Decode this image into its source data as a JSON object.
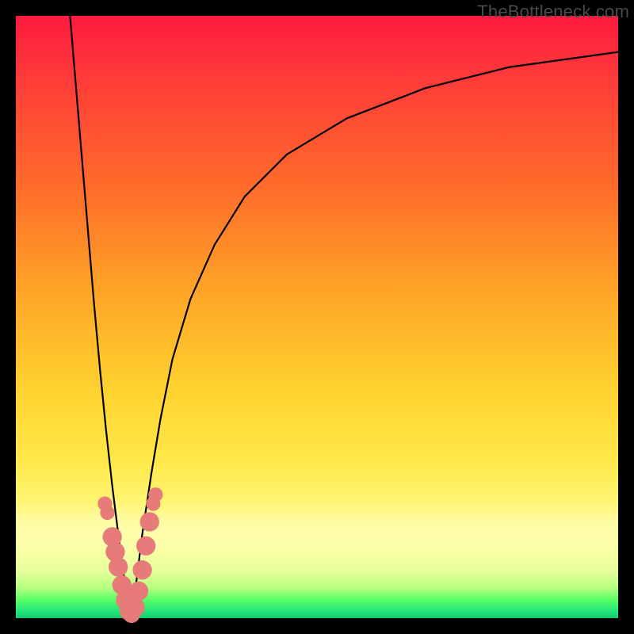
{
  "watermark": "TheBottleneck.com",
  "chart_data": {
    "type": "line",
    "title": "",
    "xlabel": "",
    "ylabel": "",
    "xlim": [
      0,
      100
    ],
    "ylim": [
      0,
      100
    ],
    "series": [
      {
        "name": "left-branch",
        "x": [
          9,
          10,
          11,
          12,
          13,
          14,
          15,
          16,
          17,
          17.8,
          18.5,
          19
        ],
        "y": [
          100,
          88,
          76,
          64,
          52,
          41,
          31,
          22,
          14,
          8,
          3,
          0
        ]
      },
      {
        "name": "right-branch",
        "x": [
          19,
          20,
          21,
          22.5,
          24,
          26,
          29,
          33,
          38,
          45,
          55,
          68,
          82,
          100
        ],
        "y": [
          0,
          6,
          14,
          24,
          33,
          43,
          53,
          62,
          70,
          77,
          83,
          88,
          91.5,
          94
        ]
      }
    ],
    "markers": [
      {
        "name": "dot",
        "x": 14.8,
        "y": 19,
        "r": 1.2
      },
      {
        "name": "dot",
        "x": 15.2,
        "y": 17.5,
        "r": 1.2
      },
      {
        "name": "dot",
        "x": 16.0,
        "y": 13.5,
        "r": 1.6
      },
      {
        "name": "dot",
        "x": 16.5,
        "y": 11.0,
        "r": 1.6
      },
      {
        "name": "dot",
        "x": 17.0,
        "y": 8.5,
        "r": 1.6
      },
      {
        "name": "dot",
        "x": 17.6,
        "y": 5.5,
        "r": 1.6
      },
      {
        "name": "dot",
        "x": 18.2,
        "y": 3.0,
        "r": 1.6
      },
      {
        "name": "dot",
        "x": 18.8,
        "y": 1.2,
        "r": 1.6
      },
      {
        "name": "dot",
        "x": 19.2,
        "y": 0.6,
        "r": 1.4
      },
      {
        "name": "dot",
        "x": 19.8,
        "y": 1.8,
        "r": 1.6
      },
      {
        "name": "dot",
        "x": 20.4,
        "y": 4.5,
        "r": 1.6
      },
      {
        "name": "dot",
        "x": 21.0,
        "y": 8.0,
        "r": 1.6
      },
      {
        "name": "dot",
        "x": 21.6,
        "y": 12.0,
        "r": 1.6
      },
      {
        "name": "dot",
        "x": 22.2,
        "y": 16.0,
        "r": 1.6
      },
      {
        "name": "dot",
        "x": 22.8,
        "y": 19.0,
        "r": 1.2
      },
      {
        "name": "dot",
        "x": 23.2,
        "y": 20.5,
        "r": 1.2
      }
    ],
    "marker_color": "#e77b79",
    "curve_color": "#000000",
    "curve_width": 2.2
  }
}
